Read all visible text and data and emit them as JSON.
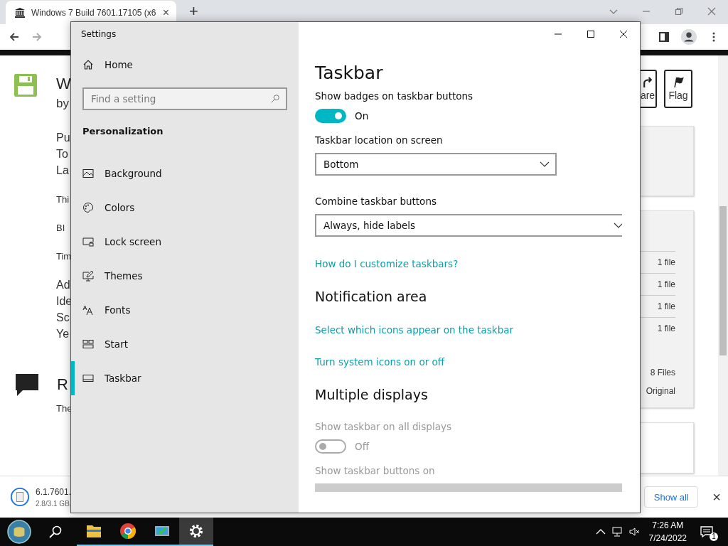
{
  "browser": {
    "tab": {
      "title": "Windows 7 Build 7601.17105 (x6",
      "close": "×"
    },
    "new_tab": "+",
    "article": {
      "title": "W",
      "byline": "by",
      "meta": [
        "Pu",
        "To",
        "La"
      ],
      "paragraphs": [
        "Thi",
        "BI",
        "Tim"
      ],
      "details": [
        "Ad",
        "Ide",
        "Sc",
        "Ye"
      ],
      "section_title": "R",
      "section_text": "The"
    },
    "side": {
      "share_button": "are",
      "flag_button": "Flag",
      "file_rows": [
        "1 file",
        "1 file",
        "1 file",
        "1 file"
      ],
      "total": "8 Files",
      "original": "Original"
    },
    "download": {
      "name": "6.1.7601.",
      "progress": "2.8/3.1 GB,",
      "show_all": "Show all",
      "close": "×"
    }
  },
  "settings": {
    "title": "Settings",
    "home": "Home",
    "search": {
      "placeholder": "Find a setting"
    },
    "section": "Personalization",
    "nav": [
      {
        "label": "Background",
        "selected": false
      },
      {
        "label": "Colors",
        "selected": false
      },
      {
        "label": "Lock screen",
        "selected": false
      },
      {
        "label": "Themes",
        "selected": false
      },
      {
        "label": "Fonts",
        "selected": false
      },
      {
        "label": "Start",
        "selected": false
      },
      {
        "label": "Taskbar",
        "selected": true
      }
    ],
    "page_title": "Taskbar",
    "items": [
      {
        "kind": "toggle",
        "label": "Show badges on taskbar buttons",
        "on": true,
        "disabled": false,
        "state": "On"
      },
      {
        "kind": "dropdown",
        "label": "Taskbar location on screen",
        "value": "Bottom"
      },
      {
        "kind": "dropdown",
        "label": "Combine taskbar buttons",
        "value": "Always, hide labels",
        "wide": true
      },
      {
        "kind": "link",
        "label": "How do I customize taskbars?"
      },
      {
        "kind": "heading",
        "label": "Notification area"
      },
      {
        "kind": "link",
        "label": "Select which icons appear on the taskbar"
      },
      {
        "kind": "link",
        "label": "Turn system icons on or off"
      },
      {
        "kind": "heading",
        "label": "Multiple displays"
      },
      {
        "kind": "toggle",
        "label": "Show taskbar on all displays",
        "on": false,
        "disabled": true,
        "state": "Off"
      },
      {
        "kind": "dropdown",
        "label": "Show taskbar buttons on",
        "disabled": true
      }
    ]
  },
  "taskbar": {
    "apps": [
      {
        "running": true,
        "selected": false
      },
      {
        "running": true,
        "selected": false
      },
      {
        "running": true,
        "selected": false
      },
      {
        "running": true,
        "selected": true
      }
    ],
    "time": "7:26 AM",
    "date": "7/24/2022",
    "notifications": "1"
  }
}
